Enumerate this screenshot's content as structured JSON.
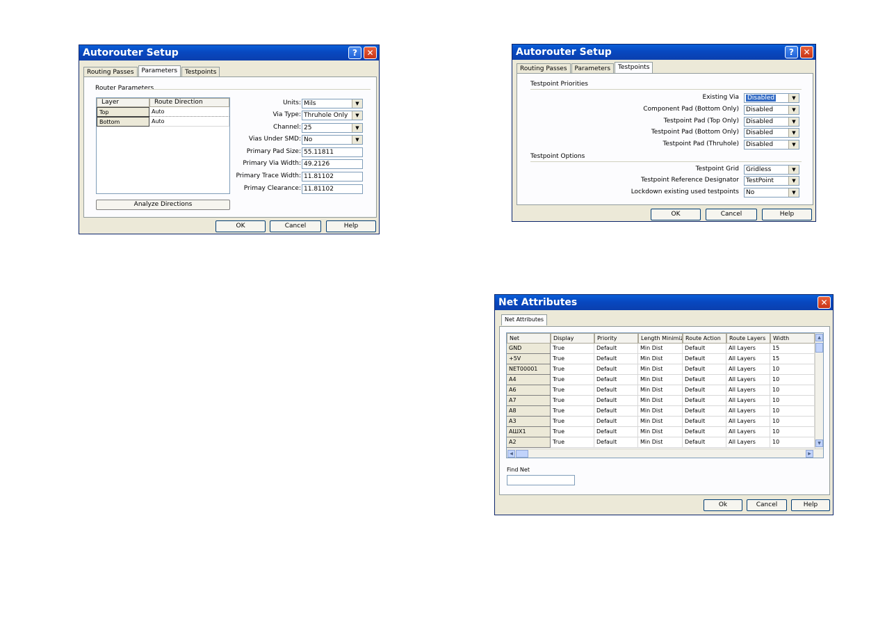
{
  "dialog1": {
    "title": "Autorouter Setup",
    "help_icon": "question-icon",
    "close_icon": "close-icon",
    "tabs": [
      "Routing Passes",
      "Parameters",
      "Testpoints"
    ],
    "active_tab": "Parameters",
    "group_label": "Router Parameters",
    "grid_headers": [
      "Layer",
      "Route Direction"
    ],
    "grid_rows": [
      {
        "layer": "Top",
        "direction": "Auto"
      },
      {
        "layer": "Bottom",
        "direction": "Auto"
      }
    ],
    "analyze_button": "Analyze Directions",
    "fields": [
      {
        "label": "Units:",
        "value": "Mils",
        "combo": true
      },
      {
        "label": "Via Type:",
        "value": "Thruhole Only",
        "combo": true
      },
      {
        "label": "Channel:",
        "value": "25",
        "combo": true
      },
      {
        "label": "Vias Under SMD:",
        "value": "No",
        "combo": true
      },
      {
        "label": "Primary Pad Size:",
        "value": "55.11811",
        "combo": false
      },
      {
        "label": "Primary Via Width:",
        "value": "49.2126",
        "combo": false
      },
      {
        "label": "Primary Trace Width:",
        "value": "11.81102",
        "combo": false
      },
      {
        "label": "Primay Clearance:",
        "value": "11.81102",
        "combo": false
      }
    ],
    "buttons": {
      "ok": "OK",
      "cancel": "Cancel",
      "help": "Help"
    }
  },
  "dialog2": {
    "title": "Autorouter Setup",
    "tabs": [
      "Routing Passes",
      "Parameters",
      "Testpoints"
    ],
    "active_tab": "Testpoints",
    "group1_label": "Testpoint Priorities",
    "priorities": [
      {
        "label": "Existing Via",
        "value": "Disabled",
        "selected": true
      },
      {
        "label": "Component Pad (Bottom Only)",
        "value": "Disabled",
        "selected": false
      },
      {
        "label": "Testpoint Pad (Top Only)",
        "value": "Disabled",
        "selected": false
      },
      {
        "label": "Testpoint Pad (Bottom Only)",
        "value": "Disabled",
        "selected": false
      },
      {
        "label": "Testpoint Pad (Thruhole)",
        "value": "Disabled",
        "selected": false
      }
    ],
    "group2_label": "Testpoint Options",
    "options": [
      {
        "label": "Testpoint Grid",
        "value": "Gridless"
      },
      {
        "label": "Testpoint Reference Designator",
        "value": "TestPoint"
      },
      {
        "label": "Lockdown existing used testpoints",
        "value": "No"
      }
    ],
    "buttons": {
      "ok": "OK",
      "cancel": "Cancel",
      "help": "Help"
    }
  },
  "dialog3": {
    "title": "Net Attributes",
    "tab": "Net Attributes",
    "columns": [
      "Net",
      "Display",
      "Priority",
      "Length Minimize",
      "Route Action",
      "Route Layers",
      "Width"
    ],
    "rows": [
      [
        "GND",
        "True",
        "Default",
        "Min Dist",
        "Default",
        "All Layers",
        "15"
      ],
      [
        "+5V",
        "True",
        "Default",
        "Min Dist",
        "Default",
        "All Layers",
        "15"
      ],
      [
        "NET00001",
        "True",
        "Default",
        "Min Dist",
        "Default",
        "All Layers",
        "10"
      ],
      [
        "A4",
        "True",
        "Default",
        "Min Dist",
        "Default",
        "All Layers",
        "10"
      ],
      [
        "A6",
        "True",
        "Default",
        "Min Dist",
        "Default",
        "All Layers",
        "10"
      ],
      [
        "A7",
        "True",
        "Default",
        "Min Dist",
        "Default",
        "All Layers",
        "10"
      ],
      [
        "A8",
        "True",
        "Default",
        "Min Dist",
        "Default",
        "All Layers",
        "10"
      ],
      [
        "A3",
        "True",
        "Default",
        "Min Dist",
        "Default",
        "All Layers",
        "10"
      ],
      [
        "AШX1",
        "True",
        "Default",
        "Min Dist",
        "Default",
        "All Layers",
        "10"
      ],
      [
        "A2",
        "True",
        "Default",
        "Min Dist",
        "Default",
        "All Layers",
        "10"
      ]
    ],
    "find_label": "Find Net",
    "find_value": "",
    "buttons": {
      "ok": "Ok",
      "cancel": "Cancel",
      "help": "Help"
    }
  }
}
